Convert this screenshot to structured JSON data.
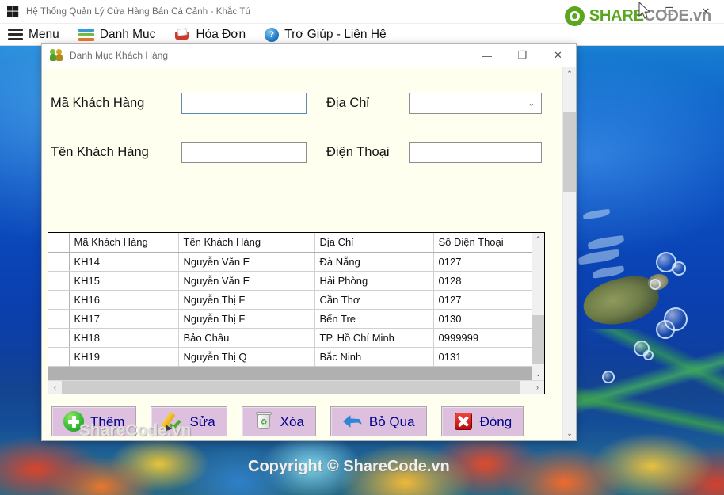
{
  "main_window": {
    "title": "Hệ Thống Quản Lý Cửa Hàng Bán Cá Cảnh - Khắc Tú",
    "window_logo_icon": "windows-logo-icon",
    "caption_buttons": [
      {
        "name": "minimize",
        "glyph": "—"
      },
      {
        "name": "maximize",
        "glyph": "❐"
      },
      {
        "name": "close",
        "glyph": "✕"
      }
    ],
    "menu": [
      {
        "label": "Menu",
        "icon": "hamburger-icon"
      },
      {
        "label": "Danh Muc",
        "icon": "stack-list-icon"
      },
      {
        "label": "Hóa Đơn",
        "icon": "invoice-icon"
      },
      {
        "label": "Trơ Giúp - Liên Hê",
        "icon": "help-question-icon"
      }
    ],
    "brand": {
      "green_part": "SHARE",
      "grey_part": "CODE.vn",
      "icon": "sharecode-logo-icon"
    }
  },
  "dialog": {
    "title": "Danh Mục Khách Hàng",
    "title_icon": "customers-icon",
    "caption_buttons": [
      {
        "name": "minimize",
        "glyph": "—"
      },
      {
        "name": "maximize",
        "glyph": "❐"
      },
      {
        "name": "close",
        "glyph": "✕"
      }
    ],
    "form": {
      "fields": [
        {
          "label": "Mã Khách Hàng",
          "value": "",
          "placeholder": "",
          "type": "text",
          "focused": true
        },
        {
          "label": "Địa Chỉ",
          "value": "",
          "placeholder": "",
          "type": "combobox",
          "focused": false
        },
        {
          "label": "Tên Khách Hàng",
          "value": "",
          "placeholder": "",
          "type": "text",
          "focused": false
        },
        {
          "label": "Điện Thoại",
          "value": "",
          "placeholder": "",
          "type": "text",
          "focused": false
        }
      ]
    },
    "grid": {
      "columns": [
        "Mã Khách Hàng",
        "Tên Khách Hàng",
        "Địa Chỉ",
        "Số Điện Thoại"
      ],
      "rows": [
        [
          "KH14",
          "Nguyễn Văn E",
          "Đà Nẵng",
          "0127"
        ],
        [
          "KH15",
          "Nguyễn Văn E",
          "Hải Phòng",
          "0128"
        ],
        [
          "KH16",
          "Nguyễn Thị F",
          "Cần Thơ",
          "0127"
        ],
        [
          "KH17",
          "Nguyễn Thị F",
          "Bến Tre",
          "0130"
        ],
        [
          "KH18",
          "Bảo Châu",
          "TP. Hồ Chí Minh",
          "0999999"
        ],
        [
          "KH19",
          "Nguyễn Thị Q",
          "Bắc Ninh",
          "0131"
        ]
      ]
    },
    "buttons": [
      {
        "label": "Thêm",
        "icon": "add-icon"
      },
      {
        "label": "Sửa",
        "icon": "edit-icon"
      },
      {
        "label": "Xóa",
        "icon": "delete-icon"
      },
      {
        "label": "Bỏ Qua",
        "icon": "back-arrow-icon"
      },
      {
        "label": "Đóng",
        "icon": "close-red-icon"
      }
    ],
    "colors": {
      "form_background": "#FFFFF0",
      "button_background": "#DDC0DD",
      "button_text": "#00008B",
      "focus_border": "#5B8BB5"
    }
  },
  "watermarks": {
    "inner": "ShareCode.vn",
    "bottom": "Copyright © ShareCode.vn"
  },
  "scrollbars": {
    "up_glyph": "⌃",
    "down_glyph": "⌄",
    "left_glyph": "‹",
    "right_glyph": "›"
  }
}
